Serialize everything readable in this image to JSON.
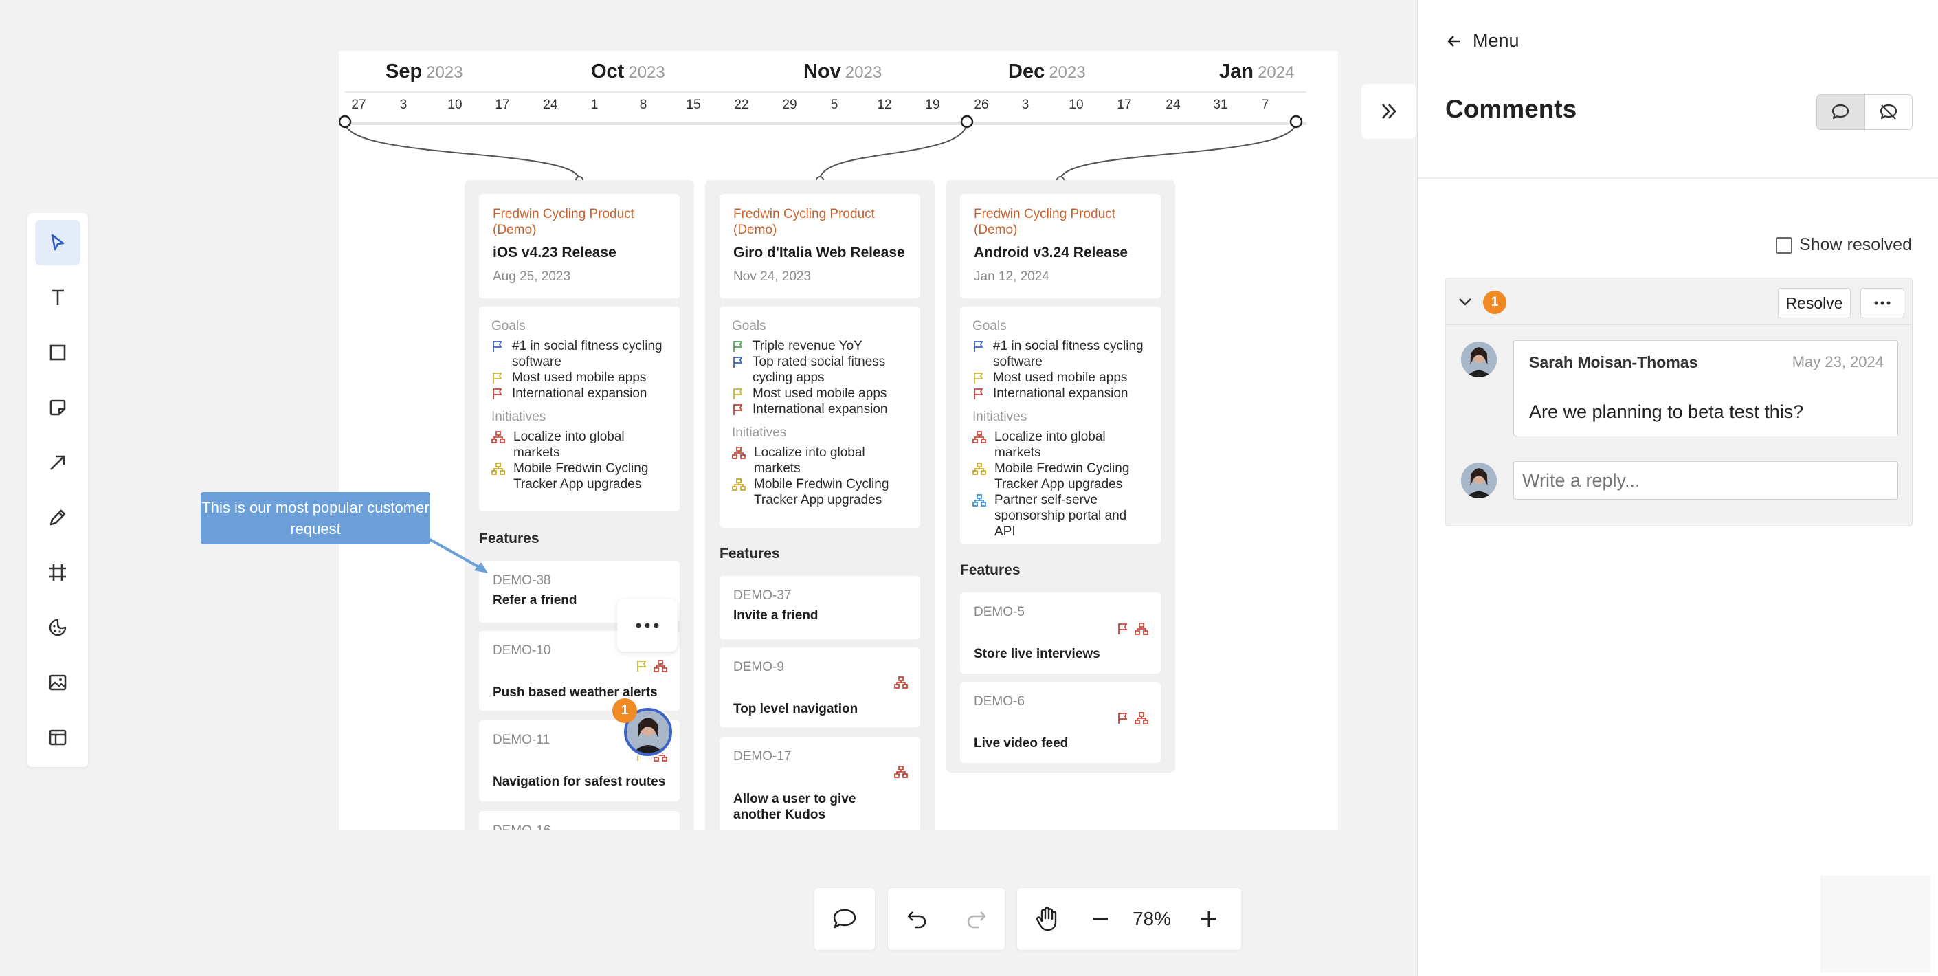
{
  "timeline": {
    "months": [
      {
        "name": "Sep",
        "year": "2023"
      },
      {
        "name": "Oct",
        "year": "2023"
      },
      {
        "name": "Nov",
        "year": "2023"
      },
      {
        "name": "Dec",
        "year": "2023"
      },
      {
        "name": "Jan",
        "year": "2024"
      }
    ],
    "ticks": [
      "27",
      "3",
      "10",
      "17",
      "24",
      "1",
      "8",
      "15",
      "22",
      "29",
      "5",
      "12",
      "19",
      "26",
      "3",
      "10",
      "17",
      "24",
      "31",
      "7"
    ]
  },
  "columns": [
    {
      "product": "Fredwin Cycling Product (Demo)",
      "release": "iOS v4.23 Release",
      "date": "Aug 25, 2023",
      "goals_label": "Goals",
      "goals": [
        "#1 in social fitness cycling software",
        "Most used mobile apps",
        "International expansion"
      ],
      "initiatives_label": "Initiatives",
      "initiatives": [
        "Localize into global markets",
        "Mobile Fredwin Cycling Tracker App upgrades"
      ],
      "features_label": "Features",
      "features": [
        {
          "id": "DEMO-38",
          "title": "Refer a friend"
        },
        {
          "id": "DEMO-10",
          "title": "Push based weather alerts"
        },
        {
          "id": "DEMO-11",
          "title": "Navigation for safest routes"
        },
        {
          "id": "DEMO-16",
          "title": ""
        }
      ]
    },
    {
      "product": "Fredwin Cycling Product (Demo)",
      "release": "Giro d'Italia Web Release",
      "date": "Nov 24, 2023",
      "goals_label": "Goals",
      "goals": [
        "Triple revenue YoY",
        "Top rated social fitness cycling apps",
        "Most used mobile apps",
        "International expansion"
      ],
      "initiatives_label": "Initiatives",
      "initiatives": [
        "Localize into global markets",
        "Mobile Fredwin Cycling Tracker App upgrades"
      ],
      "features_label": "Features",
      "features": [
        {
          "id": "DEMO-37",
          "title": "Invite a friend"
        },
        {
          "id": "DEMO-9",
          "title": "Top level navigation"
        },
        {
          "id": "DEMO-17",
          "title": "Allow a user to give another Kudos"
        }
      ]
    },
    {
      "product": "Fredwin Cycling Product (Demo)",
      "release": "Android v3.24 Release",
      "date": "Jan 12, 2024",
      "goals_label": "Goals",
      "goals": [
        "#1 in social fitness cycling software",
        "Most used mobile apps",
        "International expansion"
      ],
      "initiatives_label": "Initiatives",
      "initiatives": [
        "Localize into global markets",
        "Mobile Fredwin Cycling Tracker App upgrades",
        "Partner self-serve sponsorship portal and API"
      ],
      "features_label": "Features",
      "features": [
        {
          "id": "DEMO-5",
          "title": "Store live interviews"
        },
        {
          "id": "DEMO-6",
          "title": "Live video feed"
        }
      ]
    }
  ],
  "callout": {
    "text": "This is our most popular customer request"
  },
  "canvas_comment_count": "1",
  "toolbar": {
    "tools": [
      "select-tool",
      "text-tool",
      "shape-tool",
      "sticky-note-tool",
      "arrow-tool",
      "pen-tool",
      "frame-tool",
      "sticker-tool",
      "image-tool",
      "template-tool"
    ]
  },
  "zoom": {
    "level": "78%"
  },
  "panel": {
    "menu_label": "Menu",
    "title": "Comments",
    "show_resolved_label": "Show resolved",
    "thread": {
      "count": "1",
      "resolve_label": "Resolve",
      "comment": {
        "author": "Sarah Moisan-Thomas",
        "date": "May 23, 2024",
        "text": "Are we planning to beta test this?"
      },
      "reply_placeholder": "Write a reply..."
    }
  },
  "colors": {
    "product": "#c8602b",
    "goal_blue": "#3d63c6",
    "goal_yellow": "#c8b83a",
    "goal_red": "#c9423a",
    "goal_green": "#4fa85a",
    "init_red": "#d0493c",
    "init_yellow": "#c8aa32",
    "init_blue": "#3f8ed6",
    "callout": "#6c9fd8",
    "badge": "#f08a24",
    "active_tool": "#e4ecfa"
  }
}
